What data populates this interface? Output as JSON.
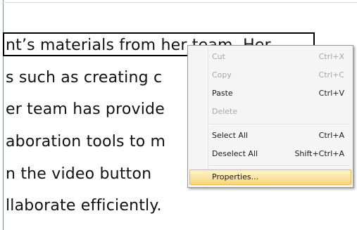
{
  "document": {
    "lines": [
      "nt’s materials from her team. Her",
      "s such as creating c",
      "er team has provide",
      "aboration tools to m",
      "n the video button",
      "llaborate efficiently."
    ]
  },
  "context_menu": {
    "items": [
      {
        "label": "Cut",
        "shortcut": "Ctrl+X",
        "enabled": false
      },
      {
        "label": "Copy",
        "shortcut": "Ctrl+C",
        "enabled": false
      },
      {
        "label": "Paste",
        "shortcut": "Ctrl+V",
        "enabled": true
      },
      {
        "label": "Delete",
        "shortcut": "",
        "enabled": false
      },
      {
        "label": "Select All",
        "shortcut": "Ctrl+A",
        "enabled": true
      },
      {
        "label": "Deselect All",
        "shortcut": "Shift+Ctrl+A",
        "enabled": true
      },
      {
        "label": "Properties...",
        "shortcut": "",
        "enabled": true,
        "highlighted": true
      }
    ]
  },
  "colors": {
    "menu_background": "#f5f5f5",
    "highlight_top": "#fdf3cf",
    "highlight_bottom": "#f8d57e",
    "disabled_text": "#a7a7a7",
    "text": "#1b1b1b"
  }
}
